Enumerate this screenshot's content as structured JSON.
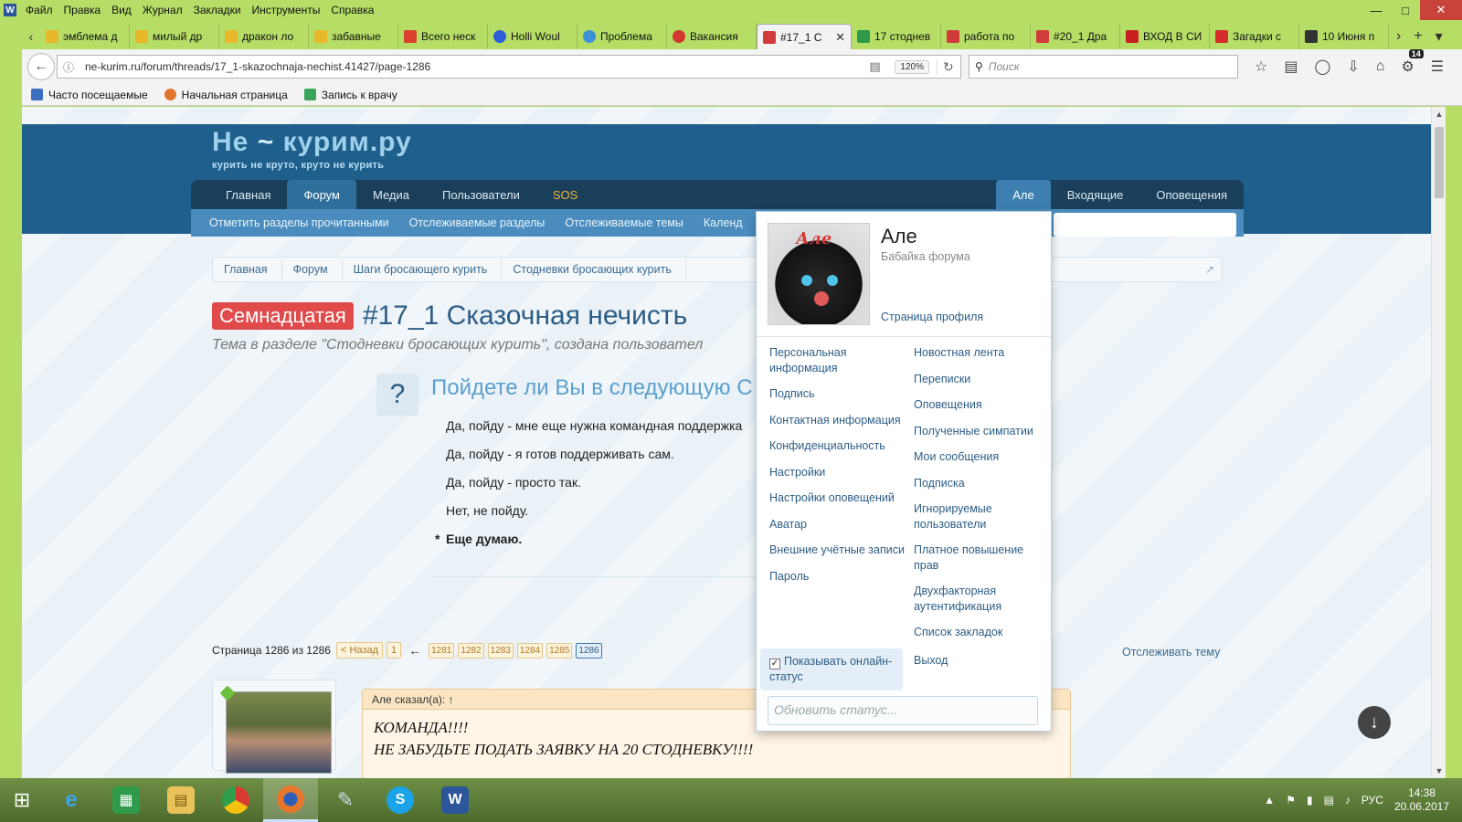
{
  "menubar": {
    "app_badge": "W",
    "items": [
      "Файл",
      "Правка",
      "Вид",
      "Журнал",
      "Закладки",
      "Инструменты",
      "Справка"
    ]
  },
  "tabs": [
    {
      "label": "эмблема д",
      "fav_color": "#e6b82a"
    },
    {
      "label": "милый др",
      "fav_color": "#e6b82a"
    },
    {
      "label": "дракон ло",
      "fav_color": "#e6b82a"
    },
    {
      "label": "забавные",
      "fav_color": "#e6b82a"
    },
    {
      "label": "Всего неск",
      "fav_color": "#d9412c"
    },
    {
      "label": "Holli Woul",
      "fav_color": "#2a5fd6"
    },
    {
      "label": "Проблема",
      "fav_color": "#3a8fd6"
    },
    {
      "label": "Вакансия",
      "fav_color": "#d2382f"
    },
    {
      "label": "#17_1 С",
      "fav_color": "#d23b3b",
      "active": true
    },
    {
      "label": "17 стоднев",
      "fav_color": "#2f9a4a"
    },
    {
      "label": "работа по",
      "fav_color": "#d23b3b"
    },
    {
      "label": "#20_1 Дра",
      "fav_color": "#d23b3b"
    },
    {
      "label": "ВХОД В СИ",
      "fav_color": "#c82020"
    },
    {
      "label": "Загадки с",
      "fav_color": "#d62c2c"
    },
    {
      "label": "10 Июня п",
      "fav_color": "#333333"
    }
  ],
  "navbar": {
    "url": "ne-kurim.ru/forum/threads/17_1-skazochnaja-nechist.41427/page-1286",
    "zoom": "120%",
    "search_placeholder": "Поиск",
    "badge_count": "14"
  },
  "bookmarks": [
    {
      "label": "Часто посещаемые",
      "color": "#3b6fc2"
    },
    {
      "label": "Начальная страница",
      "color": "#e0742c"
    },
    {
      "label": "Запись к врачу",
      "color": "#3aa55a"
    }
  ],
  "site": {
    "logo_main_a": "Не",
    "logo_main_b": "курим",
    "logo_main_c": ".ру",
    "logo_tag": "курить не круто, круто не курить",
    "nav_tabs": [
      "Главная",
      "Форум",
      "Медиа",
      "Пользователи",
      "SOS"
    ],
    "nav_right": [
      "Але",
      "Входящие",
      "Оповещения"
    ],
    "sub_nav": [
      "Отметить разделы прочитанными",
      "Отслеживаемые разделы",
      "Отслеживаемые темы",
      "Календ"
    ],
    "breadcrumb": [
      "Главная",
      "Форум",
      "Шаги бросающего курить",
      "Стодневки бросающих курить"
    ]
  },
  "thread": {
    "prefix": "Семнадцатая",
    "title": "#17_1 Сказочная нечисть",
    "meta": "Тема в разделе \"Стодневки бросающих курить\", создана пользовател"
  },
  "poll": {
    "icon": "?",
    "question": "Пойдете ли Вы в следующую С",
    "options": [
      {
        "label": "Да, пойду - мне еще нужна командная поддержка",
        "voted": false
      },
      {
        "label": "Да, пойду - я готов поддерживать сам.",
        "voted": false
      },
      {
        "label": "Да, пойду - просто так.",
        "voted": false
      },
      {
        "label": "Нет, не пойду.",
        "voted": false
      },
      {
        "label": "Еще думаю.",
        "voted": true
      }
    ]
  },
  "pagination": {
    "label": "Страница 1286 из 1286",
    "prev": "< Назад",
    "first": "1",
    "arrow": "←",
    "pages": [
      "1281",
      "1282",
      "1283",
      "1284",
      "1285"
    ],
    "current": "1286",
    "watch": "Отслеживать тему"
  },
  "post": {
    "quote_head": "Але сказал(а): ↑",
    "lines": [
      "КОМАНДА!!!!",
      "НЕ ЗАБУДЬТЕ ПОДАТЬ ЗАЯВКУ НА 20 СТОДНЕВКУ!!!!"
    ]
  },
  "account_menu": {
    "avatar_caption": "Але",
    "username": "Але",
    "user_title": "Бабайка форума",
    "profile_link": "Страница профиля",
    "left_items": [
      "Персональная информация",
      "Подпись",
      "Контактная информация",
      "Конфиденциальность",
      "Настройки",
      "Настройки оповещений",
      "Аватар",
      "Внешние учётные записи",
      "Пароль"
    ],
    "right_items": [
      "Новостная лента",
      "Переписки",
      "Оповещения",
      "Полученные симпатии",
      "Мои сообщения",
      "Подписка",
      "Игнорируемые пользователи",
      "Платное повышение прав",
      "Двухфакторная аутентификация",
      "Список закладок"
    ],
    "online_status": "Показывать онлайн-статус",
    "logout": "Выход",
    "status_placeholder": "Обновить статус..."
  },
  "taskbar": {
    "apps": [
      "internet-explorer",
      "store",
      "file-explorer",
      "chrome",
      "firefox",
      "paint",
      "skype",
      "word"
    ],
    "lang": "РУС",
    "time": "14:38",
    "date": "20.06.2017"
  }
}
